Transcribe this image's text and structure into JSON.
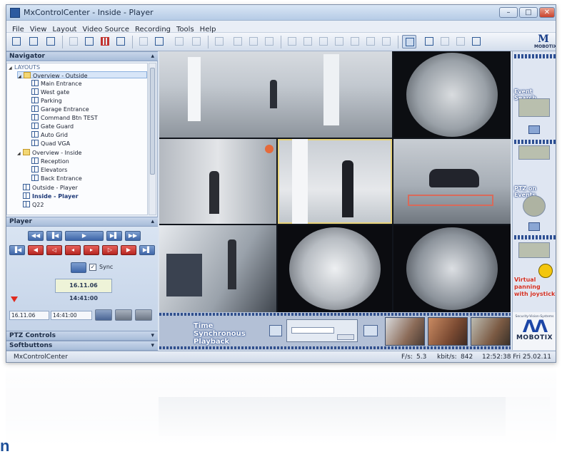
{
  "window": {
    "title": "MxControlCenter - Inside - Player",
    "controls": [
      "–",
      "□",
      "✕"
    ]
  },
  "menu": [
    "File",
    "View",
    "Layout",
    "Video Source",
    "Recording",
    "Tools",
    "Help"
  ],
  "toolbar": {
    "logo_text": "MOBOTIX"
  },
  "navigator": {
    "header": "Navigator",
    "pin": "▴",
    "root_label": "LAYOUTS",
    "items": [
      {
        "label": "Overview - Outside",
        "icon": "folder-icon",
        "level": 1,
        "selected": true
      },
      {
        "label": "Main Entrance",
        "icon": "camera-layout-icon",
        "level": 2
      },
      {
        "label": "West gate",
        "icon": "camera-layout-icon",
        "level": 2
      },
      {
        "label": "Parking",
        "icon": "camera-layout-icon",
        "level": 2
      },
      {
        "label": "Garage Entrance",
        "icon": "camera-layout-icon",
        "level": 2
      },
      {
        "label": "Command Btn TEST",
        "icon": "camera-layout-icon",
        "level": 2
      },
      {
        "label": "Gate Guard",
        "icon": "camera-layout-icon",
        "level": 2
      },
      {
        "label": "Auto Grid",
        "icon": "camera-layout-icon",
        "level": 2
      },
      {
        "label": "Quad VGA",
        "icon": "camera-layout-icon",
        "level": 2
      },
      {
        "label": "Overview - Inside",
        "icon": "folder-icon",
        "level": 1
      },
      {
        "label": "Reception",
        "icon": "camera-layout-icon",
        "level": 2
      },
      {
        "label": "Elevators",
        "icon": "camera-layout-icon",
        "level": 2
      },
      {
        "label": "Back Entrance",
        "icon": "camera-layout-icon",
        "level": 2
      },
      {
        "label": "Outside - Player",
        "icon": "camera-layout-icon",
        "level": 1
      },
      {
        "label": "Inside - Player",
        "icon": "camera-layout-icon",
        "level": 1,
        "bold": true
      },
      {
        "label": "Q22",
        "icon": "camera-layout-icon",
        "level": 1
      }
    ]
  },
  "player": {
    "header": "Player",
    "pin": "▴",
    "sync_label": "Sync",
    "sync_checked": "✓",
    "timestamp": "16.11.06 14:41:00",
    "date_value": "16.11.06",
    "time_value": "14:41:00"
  },
  "ptz_controls": {
    "header": "PTZ Controls",
    "pin": "▾"
  },
  "softbuttons": {
    "header": "Softbuttons",
    "pin": "▾"
  },
  "statusbar": {
    "app_name": "MxControlCenter",
    "fps_label": "F/s:",
    "fps_value": "5.3",
    "kbits_label": "kbit/s:",
    "kbits_value": "842",
    "datetime": "12:52:38 Fri 25.02.11"
  },
  "event_panel": {
    "event_search": "Event Search",
    "ptz_on_events": "PTZ on Events",
    "virtual_panning": "Virtual panning with joystick"
  },
  "sync_strip": {
    "title_line1": "Time Synchronous",
    "title_line2": "Playback"
  },
  "brand": {
    "tagline": "Security-Vision-Systems",
    "wordmark": "MOBOTIX"
  },
  "footer": {
    "fragment": "n"
  },
  "colors": {
    "accent_blue": "#2c5aa0",
    "record_red": "#e02a1f",
    "panel_bg": "#e9eff7"
  }
}
